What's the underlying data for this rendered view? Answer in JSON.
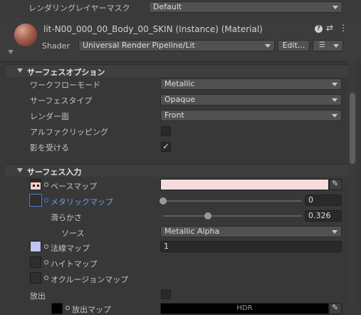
{
  "top_row": {
    "label": "レンダリングレイヤーマスク",
    "value": "Default"
  },
  "material": {
    "title": "lit-N00_000_00_Body_00_SKIN (Instance) (Material)",
    "shader_label": "Shader",
    "shader_value": "Universal Render Pipeline/Lit",
    "edit_label": "Edit..."
  },
  "surface_options": {
    "title": "サーフェスオプション",
    "rows": [
      {
        "label": "ワークフローモード",
        "value": "Metallic"
      },
      {
        "label": "サーフェスタイプ",
        "value": "Opaque"
      },
      {
        "label": "レンダー面",
        "value": "Front"
      }
    ],
    "alpha_clip_label": "アルファクリッピング",
    "receive_shadows_label": "影を受ける",
    "checkmark": "✓"
  },
  "surface_inputs": {
    "title": "サーフェス入力",
    "base_map_label": "ベースマップ",
    "base_color": "#f6dcdc",
    "metallic_map_label": "メタリックマップ",
    "metallic_value": "0",
    "metallic_fraction": 0.0,
    "smoothness_label": "滑らかさ",
    "smoothness_value": "0.326",
    "smoothness_fraction": 0.326,
    "source_label": "ソース",
    "source_value": "Metallic Alpha",
    "normal_map_label": "法線マップ",
    "normal_value": "1",
    "height_map_label": "ハイトマップ",
    "occlusion_map_label": "オクルージョンマップ",
    "emission_label": "放出",
    "emission_map_label": "放出マップ",
    "hdr_label": "HDR"
  },
  "colors": {
    "accent": "#4a7cc9",
    "panel": "#383838",
    "normal_thumb": "#c2c2f5"
  },
  "icons": [
    "help-icon",
    "preset-icon",
    "more-icon",
    "eyedropper-icon",
    "layers-icon"
  ]
}
